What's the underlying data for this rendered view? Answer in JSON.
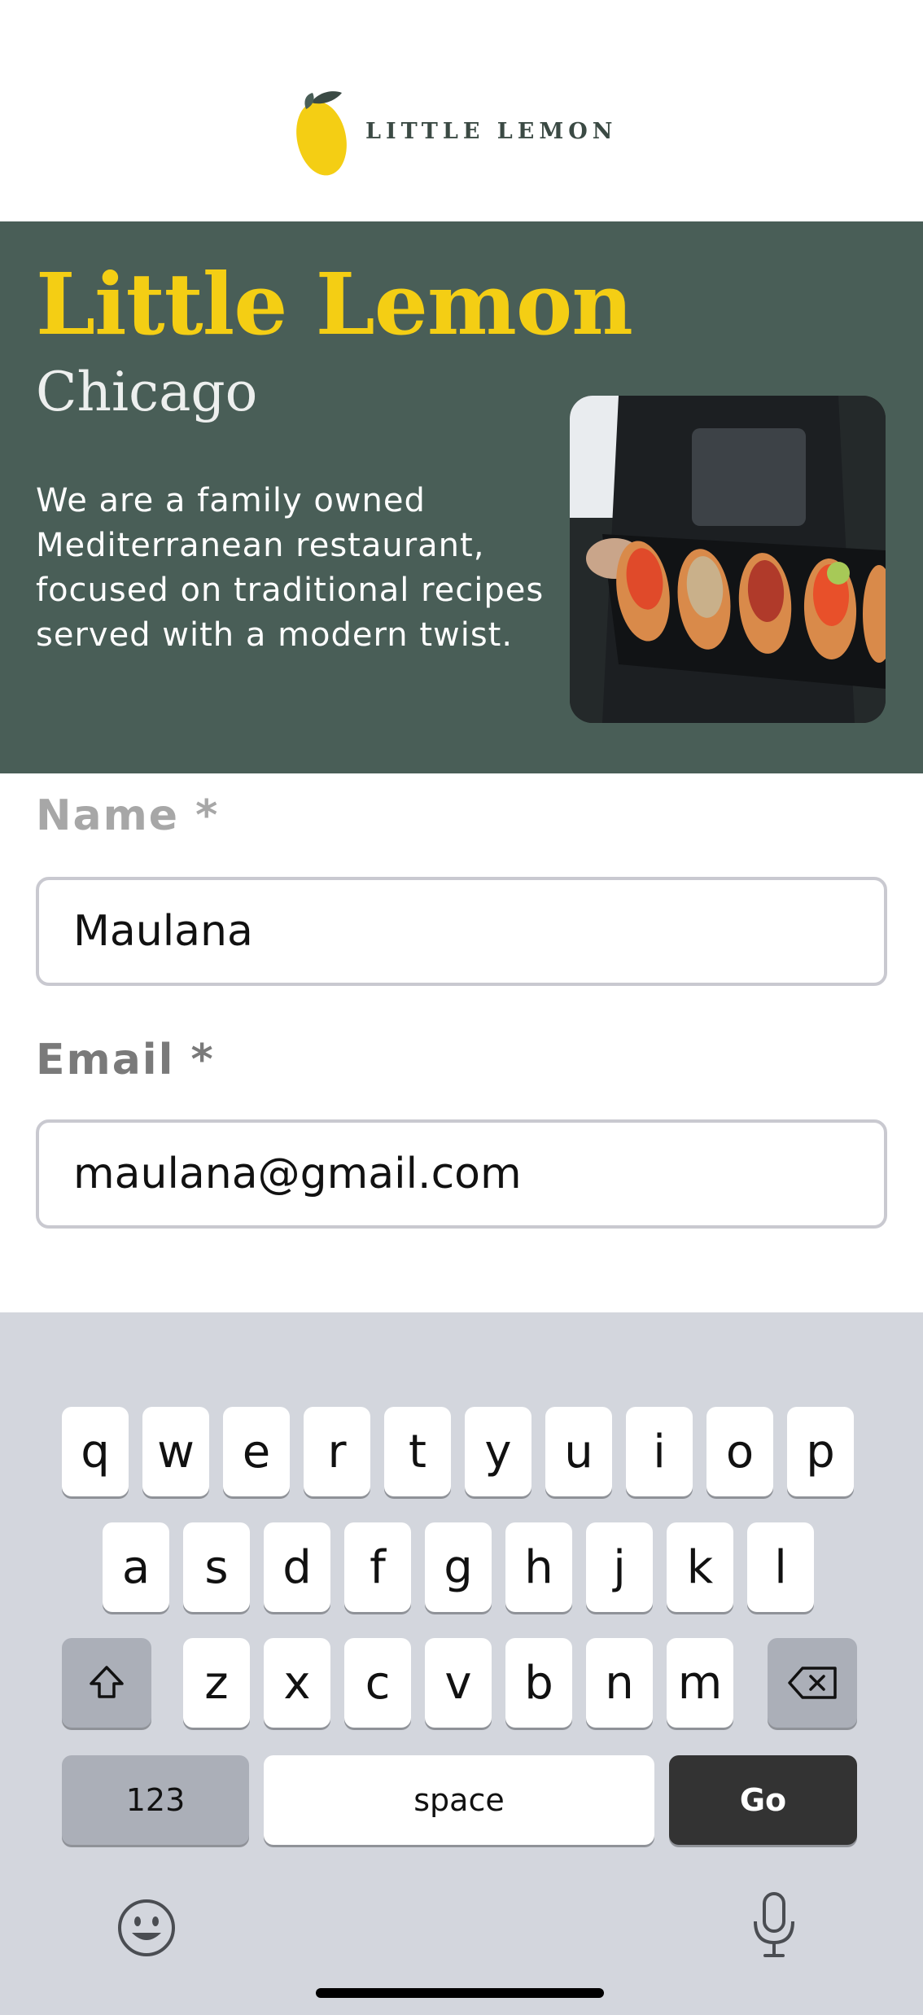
{
  "header": {
    "logo_text": "LITTLE LEMON",
    "logo_icon": "lemon-icon"
  },
  "hero": {
    "title": "Little Lemon",
    "subtitle": "Chicago",
    "description": "We are a family owned Mediterranean restaurant, focused on traditional recipes served with a modern twist.",
    "image": "food-platter-image"
  },
  "form": {
    "name_label": "Name *",
    "name_value": "Maulana",
    "email_label": "Email *",
    "email_value": "maulana@gmail.com"
  },
  "keyboard": {
    "row1": [
      "q",
      "w",
      "e",
      "r",
      "t",
      "y",
      "u",
      "i",
      "o",
      "p"
    ],
    "row2": [
      "a",
      "s",
      "d",
      "f",
      "g",
      "h",
      "j",
      "k",
      "l"
    ],
    "row3": [
      "z",
      "x",
      "c",
      "v",
      "b",
      "n",
      "m"
    ],
    "numbers_label": "123",
    "space_label": "space",
    "go_label": "Go",
    "icons": [
      "shift-icon",
      "backspace-icon",
      "emoji-icon",
      "microphone-icon"
    ]
  },
  "colors": {
    "hero_bg": "#495e57",
    "brand_yellow": "#f4ce14",
    "keyboard_bg": "#d3d6dd"
  }
}
